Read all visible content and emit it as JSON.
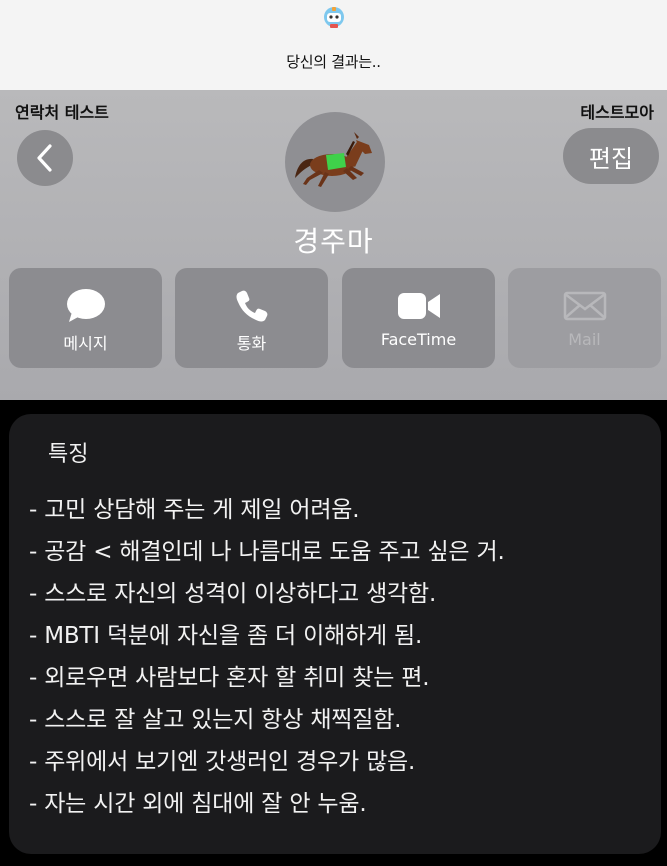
{
  "header": {
    "title": "당신의 결과는..",
    "logo_icon": "robot-mascot-icon"
  },
  "contact": {
    "left_label": "연락처 테스트",
    "right_label": "테스트모아",
    "back_icon": "chevron-left-icon",
    "edit_label": "편집",
    "avatar_icon": "racehorse-icon",
    "name": "경주마"
  },
  "actions": [
    {
      "label": "메시지",
      "icon": "message-bubble-icon",
      "enabled": true
    },
    {
      "label": "통화",
      "icon": "phone-icon",
      "enabled": true
    },
    {
      "label": "FaceTime",
      "icon": "video-camera-icon",
      "enabled": true
    },
    {
      "label": "Mail",
      "icon": "mail-envelope-icon",
      "enabled": false
    }
  ],
  "features": {
    "title": "특징",
    "items": [
      "- 고민 상담해 주는 게 제일 어려움.",
      "- 공감 < 해결인데 나 나름대로 도움 주고 싶은 거.",
      "- 스스로 자신의 성격이 이상하다고 생각함.",
      "- MBTI 덕분에 자신을 좀 더 이해하게 됨.",
      "- 외로우면 사람보다 혼자 할 취미 찾는 편.",
      "- 스스로 잘 살고 있는지 항상 채찍질함.",
      "- 주위에서 보기엔 갓생러인 경우가 많음.",
      "- 자는 시간 외에 침대에 잘 안 누움."
    ]
  },
  "colors": {
    "card_bg": "#b2b2b5",
    "button_bg": "#8c8c90",
    "panel_bg": "#1b1b1d",
    "saddle_green": "#3fd14a"
  }
}
